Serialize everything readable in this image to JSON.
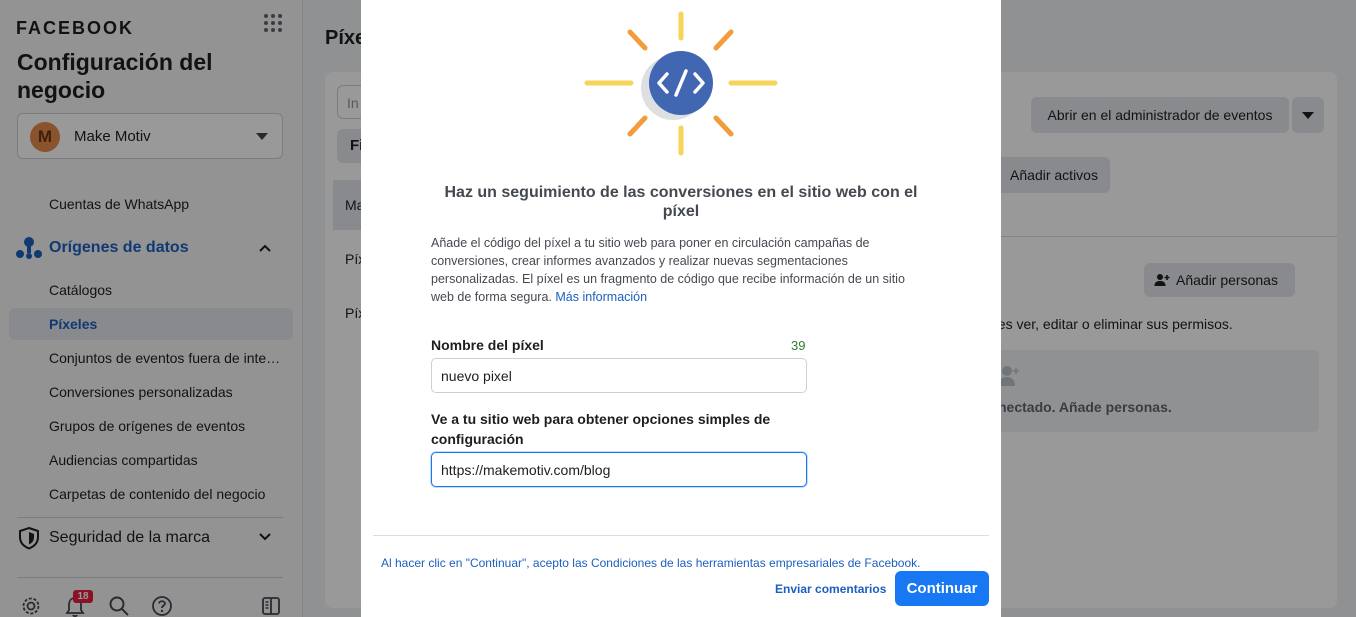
{
  "sidebar": {
    "brand": "FACEBOOK",
    "title": "Configuración del negocio",
    "business": {
      "avatar_letter": "M",
      "name": "Make Motiv"
    },
    "items_top": [
      {
        "label": "Cuentas de WhatsApp"
      }
    ],
    "section_data_sources": {
      "label": "Orígenes de datos"
    },
    "data_sources_items": [
      {
        "label": "Catálogos"
      },
      {
        "label": "Píxeles",
        "active": true
      },
      {
        "label": "Conjuntos de eventos fuera de inte…"
      },
      {
        "label": "Conversiones personalizadas"
      },
      {
        "label": "Grupos de orígenes de eventos"
      },
      {
        "label": "Audiencias compartidas"
      },
      {
        "label": "Carpetas de contenido del negocio"
      }
    ],
    "section_brand_safety": {
      "label": "Seguridad de la marca"
    },
    "footer": {
      "notification_count": "18"
    }
  },
  "background": {
    "page_title": "Píxe",
    "left_panel": {
      "search_placeholder": "In",
      "filter_label": "Fi",
      "rows": [
        "Ma",
        "Píx",
        "Píx"
      ]
    },
    "right_panel": {
      "open_events_manager": "Abrir en el administrador de eventos",
      "add_assets": "Añadir activos",
      "add_people": "Añadir personas",
      "permissions_text": "des ver, editar o eliminar sus permisos.",
      "empty_text": "nectado. Añade personas."
    }
  },
  "modal": {
    "heading": "Haz un seguimiento de las conversiones en el sitio web con el píxel",
    "description": "Añade el código del píxel a tu sitio web para poner en circulación campañas de conversiones, crear informes avanzados y realizar nuevas segmentaciones personalizadas. El píxel es un fragmento de código que recibe información de un sitio web de forma segura.",
    "learn_more": "Más información",
    "pixel_name_label": "Nombre del píxel",
    "pixel_name_counter": "39",
    "pixel_name_value": "nuevo pixel",
    "website_label": "Ve a tu sitio web para obtener opciones simples de configuración",
    "website_value": "https://makemotiv.com/blog",
    "terms_text": "Al hacer clic en \"Continuar\", acepto las Condiciones de las herramientas empresariales de Facebook.",
    "feedback_label": "Enviar comentarios",
    "continue_label": "Continuar"
  },
  "colors": {
    "primary": "#1877f2",
    "link": "#1b5fbf",
    "icon_circle": "#4267b2",
    "sun_yellow": "#f7d358",
    "sun_orange": "#f39c3c",
    "badge_red": "#e41e3f"
  }
}
